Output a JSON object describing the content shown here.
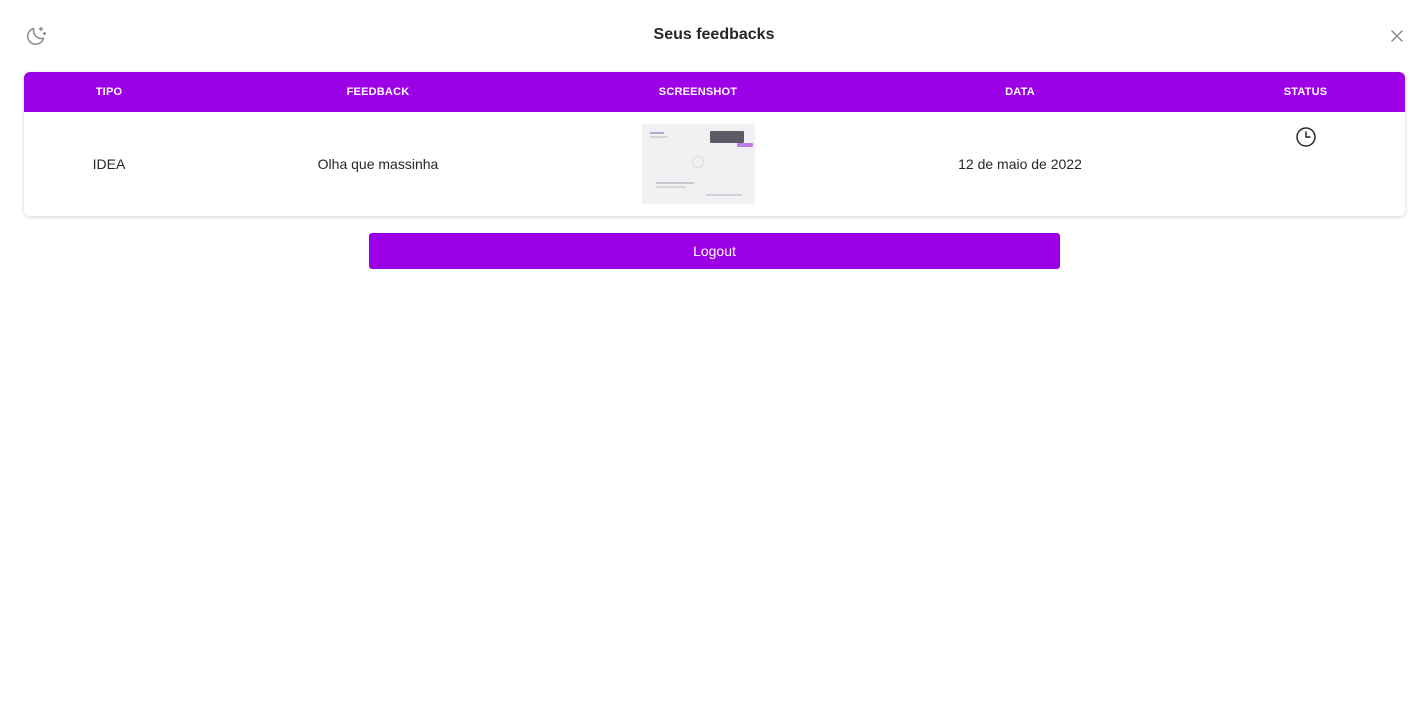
{
  "header": {
    "title": "Seus feedbacks",
    "theme_icon": "moon-stars-icon",
    "close_icon": "close-icon"
  },
  "table": {
    "columns": [
      "TIPO",
      "FEEDBACK",
      "SCREENSHOT",
      "DATA",
      "STATUS"
    ],
    "rows": [
      {
        "type": "IDEA",
        "feedback": "Olha que massinha",
        "screenshot_icon": "screenshot-thumbnail",
        "date": "12 de maio de 2022",
        "status_icon": "clock-icon"
      }
    ]
  },
  "actions": {
    "logout_label": "Logout"
  },
  "colors": {
    "accent": "#9c00e6",
    "text": "#27272a",
    "background": "#ffffff"
  }
}
